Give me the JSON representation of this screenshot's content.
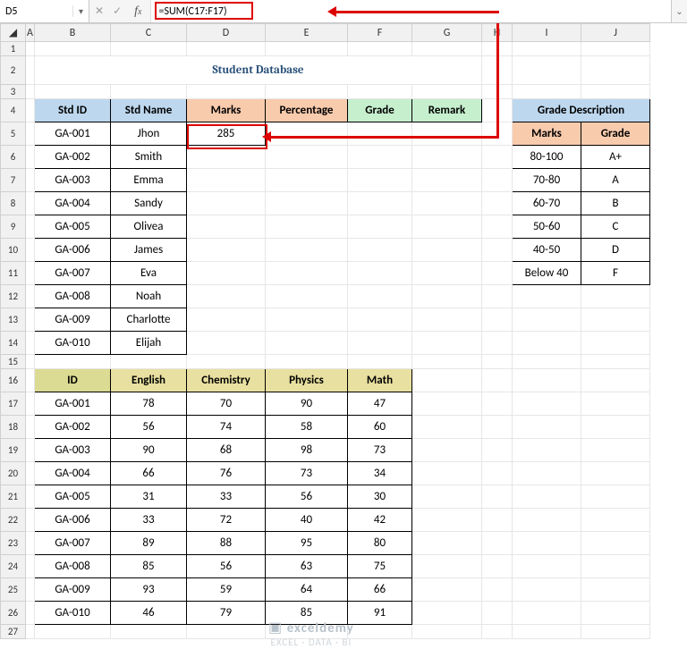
{
  "namebox": "D5",
  "formula": "=SUM(C17:F17)",
  "title": "Student Database",
  "columns": [
    "A",
    "B",
    "C",
    "D",
    "E",
    "F",
    "G",
    "H",
    "I",
    "J"
  ],
  "headers_top": {
    "std_id": "Std ID",
    "std_name": "Std Name",
    "marks": "Marks",
    "percentage": "Percentage",
    "grade": "Grade",
    "remark": "Remark"
  },
  "students": [
    {
      "id": "GA-001",
      "name": "Jhon",
      "marks": "285"
    },
    {
      "id": "GA-002",
      "name": "Smith",
      "marks": ""
    },
    {
      "id": "GA-003",
      "name": "Emma",
      "marks": ""
    },
    {
      "id": "GA-004",
      "name": "Sandy",
      "marks": ""
    },
    {
      "id": "GA-005",
      "name": "Olivea",
      "marks": ""
    },
    {
      "id": "GA-006",
      "name": "James",
      "marks": ""
    },
    {
      "id": "GA-007",
      "name": "Eva",
      "marks": ""
    },
    {
      "id": "GA-008",
      "name": "Noah",
      "marks": ""
    },
    {
      "id": "GA-009",
      "name": "Charlotte",
      "marks": ""
    },
    {
      "id": "GA-010",
      "name": "Elijah",
      "marks": ""
    }
  ],
  "headers_scores": {
    "id": "ID",
    "english": "English",
    "chemistry": "Chemistry",
    "physics": "Physics",
    "math": "Math"
  },
  "scores": [
    {
      "id": "GA-001",
      "en": "78",
      "ch": "70",
      "ph": "90",
      "ma": "47"
    },
    {
      "id": "GA-002",
      "en": "56",
      "ch": "74",
      "ph": "58",
      "ma": "60"
    },
    {
      "id": "GA-003",
      "en": "90",
      "ch": "68",
      "ph": "98",
      "ma": "73"
    },
    {
      "id": "GA-004",
      "en": "66",
      "ch": "76",
      "ph": "73",
      "ma": "34"
    },
    {
      "id": "GA-005",
      "en": "31",
      "ch": "33",
      "ph": "56",
      "ma": "30"
    },
    {
      "id": "GA-006",
      "en": "33",
      "ch": "72",
      "ph": "40",
      "ma": "42"
    },
    {
      "id": "GA-007",
      "en": "89",
      "ch": "88",
      "ph": "95",
      "ma": "80"
    },
    {
      "id": "GA-008",
      "en": "85",
      "ch": "56",
      "ph": "63",
      "ma": "75"
    },
    {
      "id": "GA-009",
      "en": "93",
      "ch": "59",
      "ph": "64",
      "ma": "66"
    },
    {
      "id": "GA-010",
      "en": "46",
      "ch": "79",
      "ph": "85",
      "ma": "91"
    }
  ],
  "grade_desc_title": "Grade Description",
  "grade_headers": {
    "marks": "Marks",
    "grade": "Grade"
  },
  "grade_rows": [
    {
      "m": "80-100",
      "g": "A+"
    },
    {
      "m": "70-80",
      "g": "A"
    },
    {
      "m": "60-70",
      "g": "B"
    },
    {
      "m": "50-60",
      "g": "C"
    },
    {
      "m": "40-50",
      "g": "D"
    },
    {
      "m": "Below 40",
      "g": "F"
    }
  ],
  "watermark": {
    "brand": "exceldemy",
    "sub": "EXCEL · DATA · BI"
  }
}
